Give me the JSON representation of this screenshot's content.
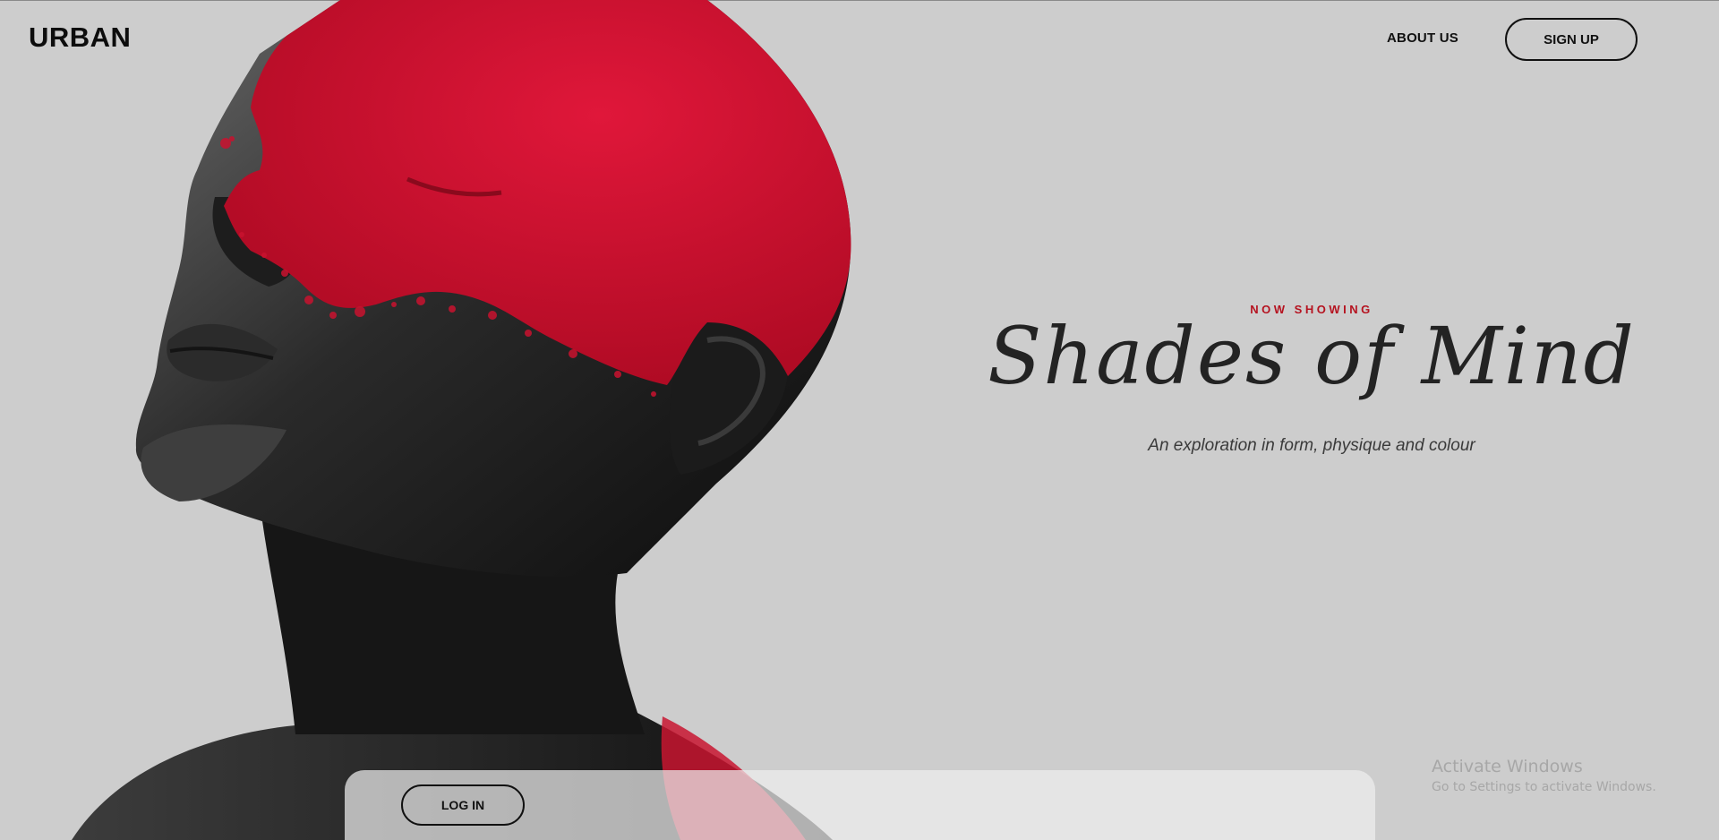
{
  "header": {
    "brand": "URBAN",
    "nav": {
      "about_label": "ABOUT US"
    },
    "signup_label": "SIGN UP"
  },
  "hero": {
    "eyebrow": "NOW SHOWING",
    "title": "Shades of Mind",
    "subtitle": "An exploration in form, physique and colour",
    "image_icon": "red-painted-face-portrait"
  },
  "panel": {
    "login_label": "LOG IN"
  },
  "watermark": {
    "title": "Activate Windows",
    "subtitle": "Go to Settings to activate Windows."
  },
  "colors": {
    "background": "#cdcdcd",
    "accent_red": "#d0102b",
    "eyebrow_red": "#b5121f",
    "ink": "#111111"
  }
}
